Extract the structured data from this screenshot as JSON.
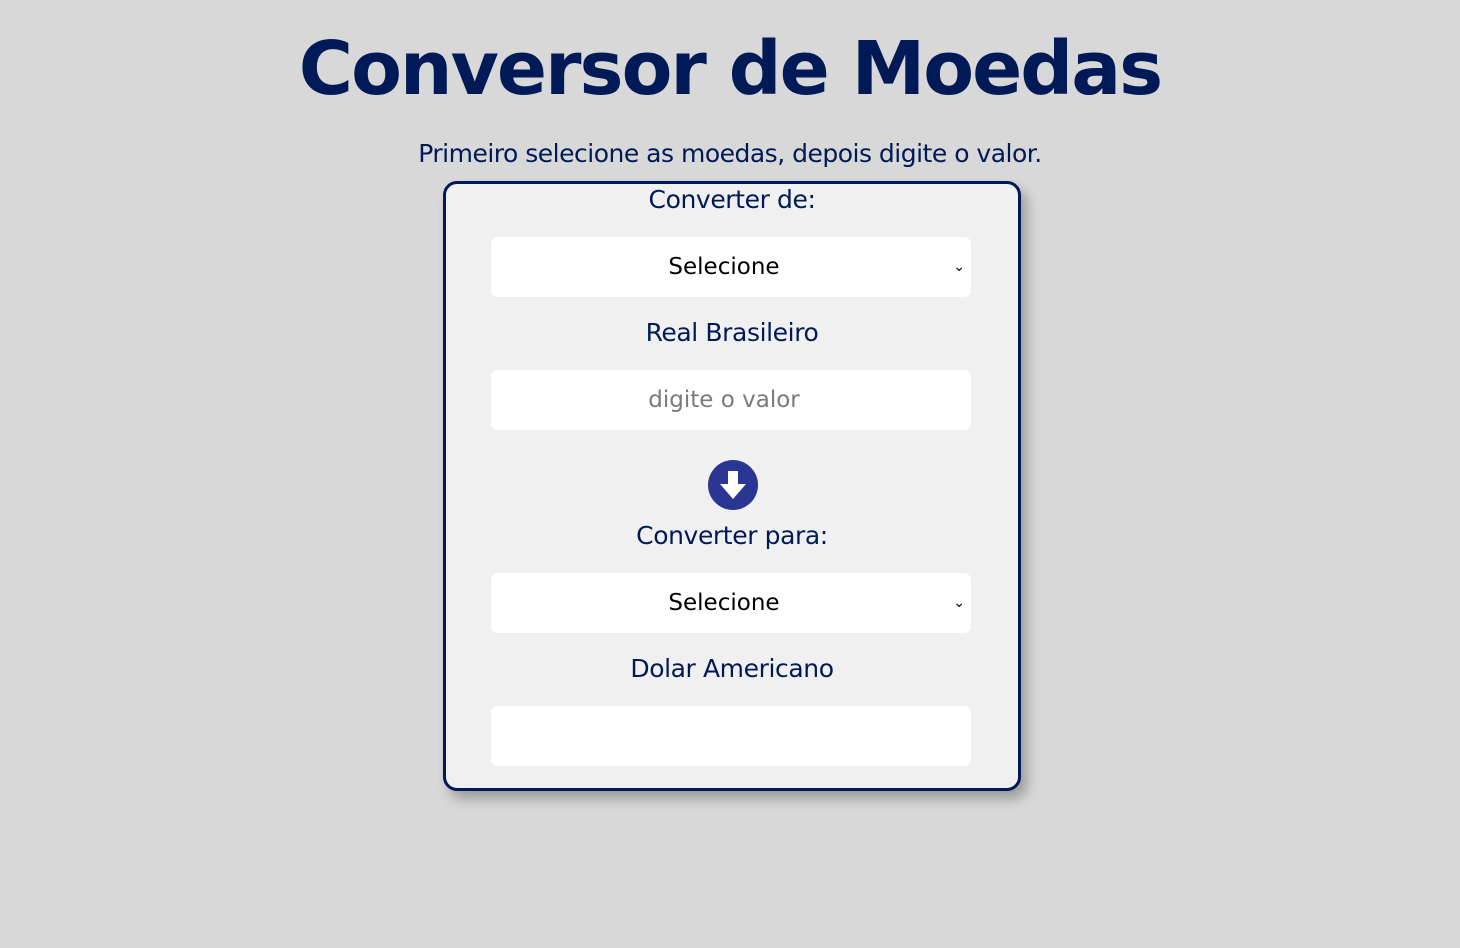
{
  "header": {
    "title": "Conversor de Moedas",
    "subtitle": "Primeiro selecione as moedas, depois digite o valor."
  },
  "from": {
    "label": "Converter de:",
    "select_value": "Selecione",
    "currency_name": "Real Brasileiro",
    "input_placeholder": "digite o valor",
    "input_value": ""
  },
  "swap": {
    "icon": "arrow-down-circle-icon"
  },
  "to": {
    "label": "Converter para:",
    "select_value": "Selecione",
    "currency_name": "Dolar Americano",
    "output_value": ""
  },
  "colors": {
    "background": "#d8d8d8",
    "card_background": "#f0f0f0",
    "text": "#001a57",
    "accent": "#2b3592"
  }
}
